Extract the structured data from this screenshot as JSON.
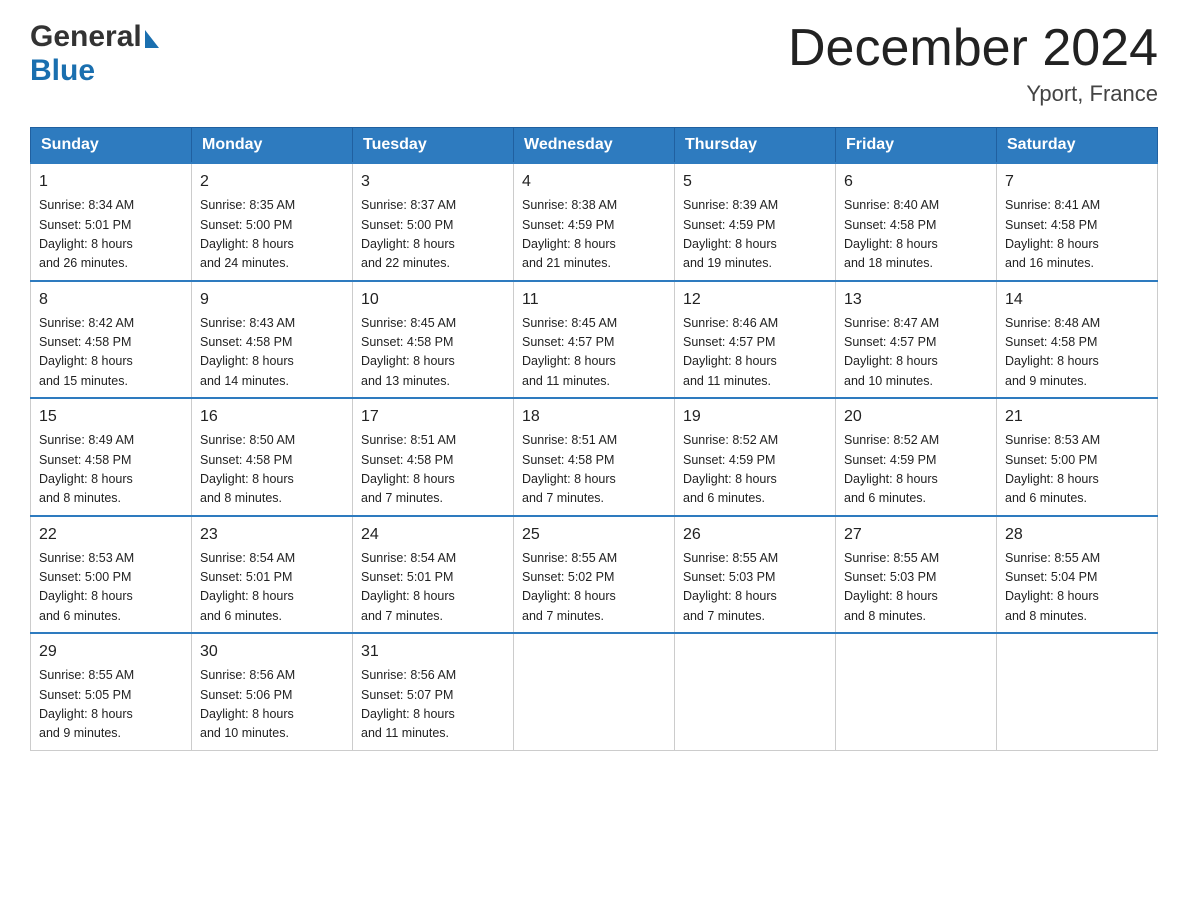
{
  "header": {
    "logo_general": "General",
    "logo_blue": "Blue",
    "month_title": "December 2024",
    "location": "Yport, France"
  },
  "weekdays": [
    "Sunday",
    "Monday",
    "Tuesday",
    "Wednesday",
    "Thursday",
    "Friday",
    "Saturday"
  ],
  "weeks": [
    [
      {
        "day": "1",
        "sunrise": "8:34 AM",
        "sunset": "5:01 PM",
        "daylight": "8 hours and 26 minutes."
      },
      {
        "day": "2",
        "sunrise": "8:35 AM",
        "sunset": "5:00 PM",
        "daylight": "8 hours and 24 minutes."
      },
      {
        "day": "3",
        "sunrise": "8:37 AM",
        "sunset": "5:00 PM",
        "daylight": "8 hours and 22 minutes."
      },
      {
        "day": "4",
        "sunrise": "8:38 AM",
        "sunset": "4:59 PM",
        "daylight": "8 hours and 21 minutes."
      },
      {
        "day": "5",
        "sunrise": "8:39 AM",
        "sunset": "4:59 PM",
        "daylight": "8 hours and 19 minutes."
      },
      {
        "day": "6",
        "sunrise": "8:40 AM",
        "sunset": "4:58 PM",
        "daylight": "8 hours and 18 minutes."
      },
      {
        "day": "7",
        "sunrise": "8:41 AM",
        "sunset": "4:58 PM",
        "daylight": "8 hours and 16 minutes."
      }
    ],
    [
      {
        "day": "8",
        "sunrise": "8:42 AM",
        "sunset": "4:58 PM",
        "daylight": "8 hours and 15 minutes."
      },
      {
        "day": "9",
        "sunrise": "8:43 AM",
        "sunset": "4:58 PM",
        "daylight": "8 hours and 14 minutes."
      },
      {
        "day": "10",
        "sunrise": "8:45 AM",
        "sunset": "4:58 PM",
        "daylight": "8 hours and 13 minutes."
      },
      {
        "day": "11",
        "sunrise": "8:45 AM",
        "sunset": "4:57 PM",
        "daylight": "8 hours and 11 minutes."
      },
      {
        "day": "12",
        "sunrise": "8:46 AM",
        "sunset": "4:57 PM",
        "daylight": "8 hours and 11 minutes."
      },
      {
        "day": "13",
        "sunrise": "8:47 AM",
        "sunset": "4:57 PM",
        "daylight": "8 hours and 10 minutes."
      },
      {
        "day": "14",
        "sunrise": "8:48 AM",
        "sunset": "4:58 PM",
        "daylight": "8 hours and 9 minutes."
      }
    ],
    [
      {
        "day": "15",
        "sunrise": "8:49 AM",
        "sunset": "4:58 PM",
        "daylight": "8 hours and 8 minutes."
      },
      {
        "day": "16",
        "sunrise": "8:50 AM",
        "sunset": "4:58 PM",
        "daylight": "8 hours and 8 minutes."
      },
      {
        "day": "17",
        "sunrise": "8:51 AM",
        "sunset": "4:58 PM",
        "daylight": "8 hours and 7 minutes."
      },
      {
        "day": "18",
        "sunrise": "8:51 AM",
        "sunset": "4:58 PM",
        "daylight": "8 hours and 7 minutes."
      },
      {
        "day": "19",
        "sunrise": "8:52 AM",
        "sunset": "4:59 PM",
        "daylight": "8 hours and 6 minutes."
      },
      {
        "day": "20",
        "sunrise": "8:52 AM",
        "sunset": "4:59 PM",
        "daylight": "8 hours and 6 minutes."
      },
      {
        "day": "21",
        "sunrise": "8:53 AM",
        "sunset": "5:00 PM",
        "daylight": "8 hours and 6 minutes."
      }
    ],
    [
      {
        "day": "22",
        "sunrise": "8:53 AM",
        "sunset": "5:00 PM",
        "daylight": "8 hours and 6 minutes."
      },
      {
        "day": "23",
        "sunrise": "8:54 AM",
        "sunset": "5:01 PM",
        "daylight": "8 hours and 6 minutes."
      },
      {
        "day": "24",
        "sunrise": "8:54 AM",
        "sunset": "5:01 PM",
        "daylight": "8 hours and 7 minutes."
      },
      {
        "day": "25",
        "sunrise": "8:55 AM",
        "sunset": "5:02 PM",
        "daylight": "8 hours and 7 minutes."
      },
      {
        "day": "26",
        "sunrise": "8:55 AM",
        "sunset": "5:03 PM",
        "daylight": "8 hours and 7 minutes."
      },
      {
        "day": "27",
        "sunrise": "8:55 AM",
        "sunset": "5:03 PM",
        "daylight": "8 hours and 8 minutes."
      },
      {
        "day": "28",
        "sunrise": "8:55 AM",
        "sunset": "5:04 PM",
        "daylight": "8 hours and 8 minutes."
      }
    ],
    [
      {
        "day": "29",
        "sunrise": "8:55 AM",
        "sunset": "5:05 PM",
        "daylight": "8 hours and 9 minutes."
      },
      {
        "day": "30",
        "sunrise": "8:56 AM",
        "sunset": "5:06 PM",
        "daylight": "8 hours and 10 minutes."
      },
      {
        "day": "31",
        "sunrise": "8:56 AM",
        "sunset": "5:07 PM",
        "daylight": "8 hours and 11 minutes."
      },
      null,
      null,
      null,
      null
    ]
  ],
  "labels": {
    "sunrise": "Sunrise:",
    "sunset": "Sunset:",
    "daylight": "Daylight:"
  }
}
